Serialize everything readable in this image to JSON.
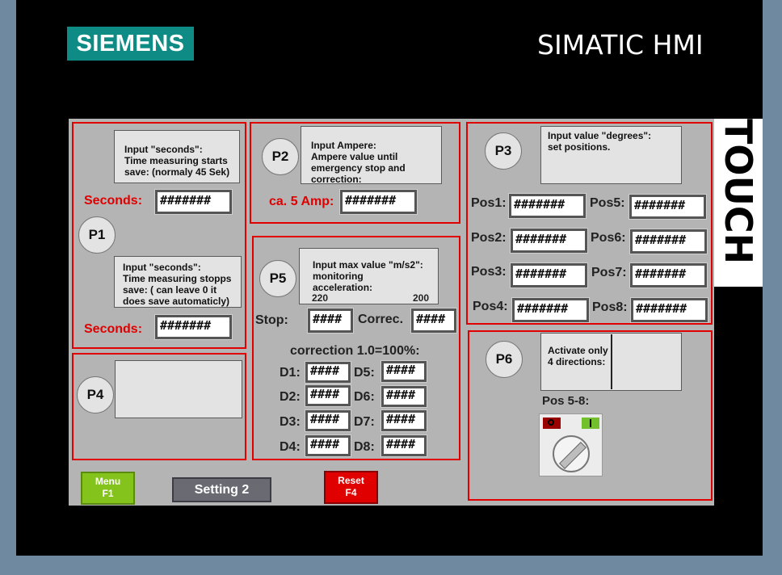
{
  "device": {
    "brand_logo": "SIEMENS",
    "brand_title": "SIMATIC HMI",
    "touch_label": "TOUCH"
  },
  "p1": {
    "badge": "P1",
    "top_desc": "Input \"seconds\":\nTime measuring starts\nsave: (normaly 45 Sek)",
    "top_label": "Seconds:",
    "top_value": "#######",
    "bottom_desc": "Input \"seconds\":\nTime measuring stopps\nsave: ( can leave 0 it\ndoes save automaticly)",
    "bottom_label": "Seconds:",
    "bottom_value": "#######"
  },
  "p2": {
    "badge": "P2",
    "desc": "Input Ampere:\nAmpere value until\nemergency stop and\ncorrection:",
    "label": "ca. 5 Amp:",
    "value": "#######"
  },
  "p3": {
    "badge": "P3",
    "desc": "Input value \"degrees\":\nset positions.",
    "positions": [
      {
        "label": "Pos1:",
        "value": "#######"
      },
      {
        "label": "Pos2:",
        "value": "#######"
      },
      {
        "label": "Pos3:",
        "value": "#######"
      },
      {
        "label": "Pos4:",
        "value": "#######"
      },
      {
        "label": "Pos5:",
        "value": "#######"
      },
      {
        "label": "Pos6:",
        "value": "#######"
      },
      {
        "label": "Pos7:",
        "value": "#######"
      },
      {
        "label": "Pos8:",
        "value": "#######"
      }
    ]
  },
  "p4": {
    "badge": "P4"
  },
  "p5": {
    "badge": "P5",
    "desc": "Input max value \"m/s2\":\nmonitoring\nacceleration:",
    "range_min": "220",
    "range_max": "200",
    "stop_label": "Stop:",
    "stop_value": "####",
    "correc_label": "Correc.",
    "correc_value": "####",
    "correction_title": "correction 1.0=100%:",
    "directions": [
      {
        "label": "D1:",
        "value": "####"
      },
      {
        "label": "D2:",
        "value": "####"
      },
      {
        "label": "D3:",
        "value": "####"
      },
      {
        "label": "D4:",
        "value": "####"
      },
      {
        "label": "D5:",
        "value": "####"
      },
      {
        "label": "D6:",
        "value": "####"
      },
      {
        "label": "D7:",
        "value": "####"
      },
      {
        "label": "D8:",
        "value": "####"
      }
    ]
  },
  "p6": {
    "badge": "P6",
    "desc": "Activate only\n4 directions:",
    "switch_label": "Pos 5-8:",
    "switch_state": "off"
  },
  "buttons": {
    "menu": "Menu\nF1",
    "setting": "Setting 2",
    "reset": "Reset\nF4"
  },
  "colors": {
    "section_border": "#e00000",
    "menu_button": "#84c21c",
    "reset_button": "#e00000",
    "setting_button": "#6a6a72",
    "logo_bg": "#0f8b86"
  }
}
